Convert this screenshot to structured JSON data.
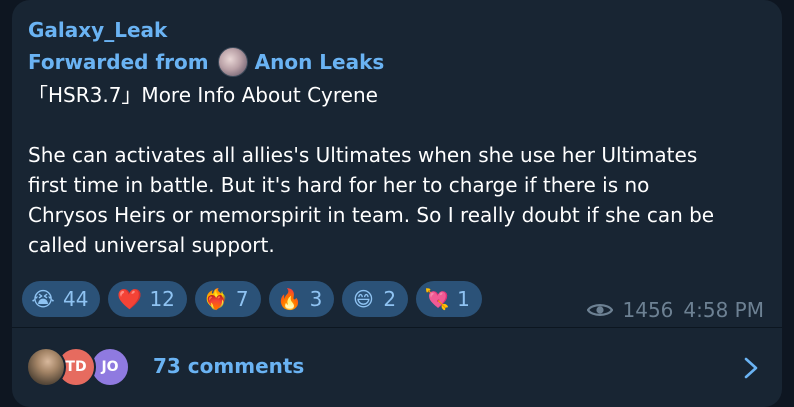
{
  "post": {
    "channel": "Galaxy_Leak",
    "forwarded_label": "Forwarded from",
    "forwarded_source": "Anon Leaks",
    "text": "「HSR3.7」More Info About Cyrene\n\nShe can activates all allies's Ultimates when she use her Ultimates\nfirst time in battle. But it's hard for her to charge if there is no\nChrysos Heirs or memorspirit in team. So I really doubt if she can be\ncalled universal support."
  },
  "reactions": [
    {
      "icon": "crying-face-emoji",
      "emoji": "😭",
      "count": "44"
    },
    {
      "icon": "red-heart-emoji",
      "emoji": "❤️",
      "count": "12"
    },
    {
      "icon": "heart-on-fire-emoji",
      "emoji": "❤️‍🔥",
      "count": "7"
    },
    {
      "icon": "fire-emoji",
      "emoji": "🔥",
      "count": "3"
    },
    {
      "icon": "grinning-face-emoji",
      "emoji": "😄",
      "count": "2"
    },
    {
      "icon": "heart-with-arrow-emoji",
      "emoji": "💘",
      "count": "1"
    }
  ],
  "meta": {
    "views": "1456",
    "time": "4:58 PM"
  },
  "comments": {
    "avatars": [
      "TD",
      "JO"
    ],
    "label": "73 comments"
  },
  "colors": {
    "background": "#0e1621",
    "bubble": "#182533",
    "accent": "#6ab3f3",
    "reaction_pill": "#2b5278",
    "meta_text": "#6d8193",
    "avatar_td": "#e66b5f",
    "avatar_jo": "#8f7ae0"
  }
}
